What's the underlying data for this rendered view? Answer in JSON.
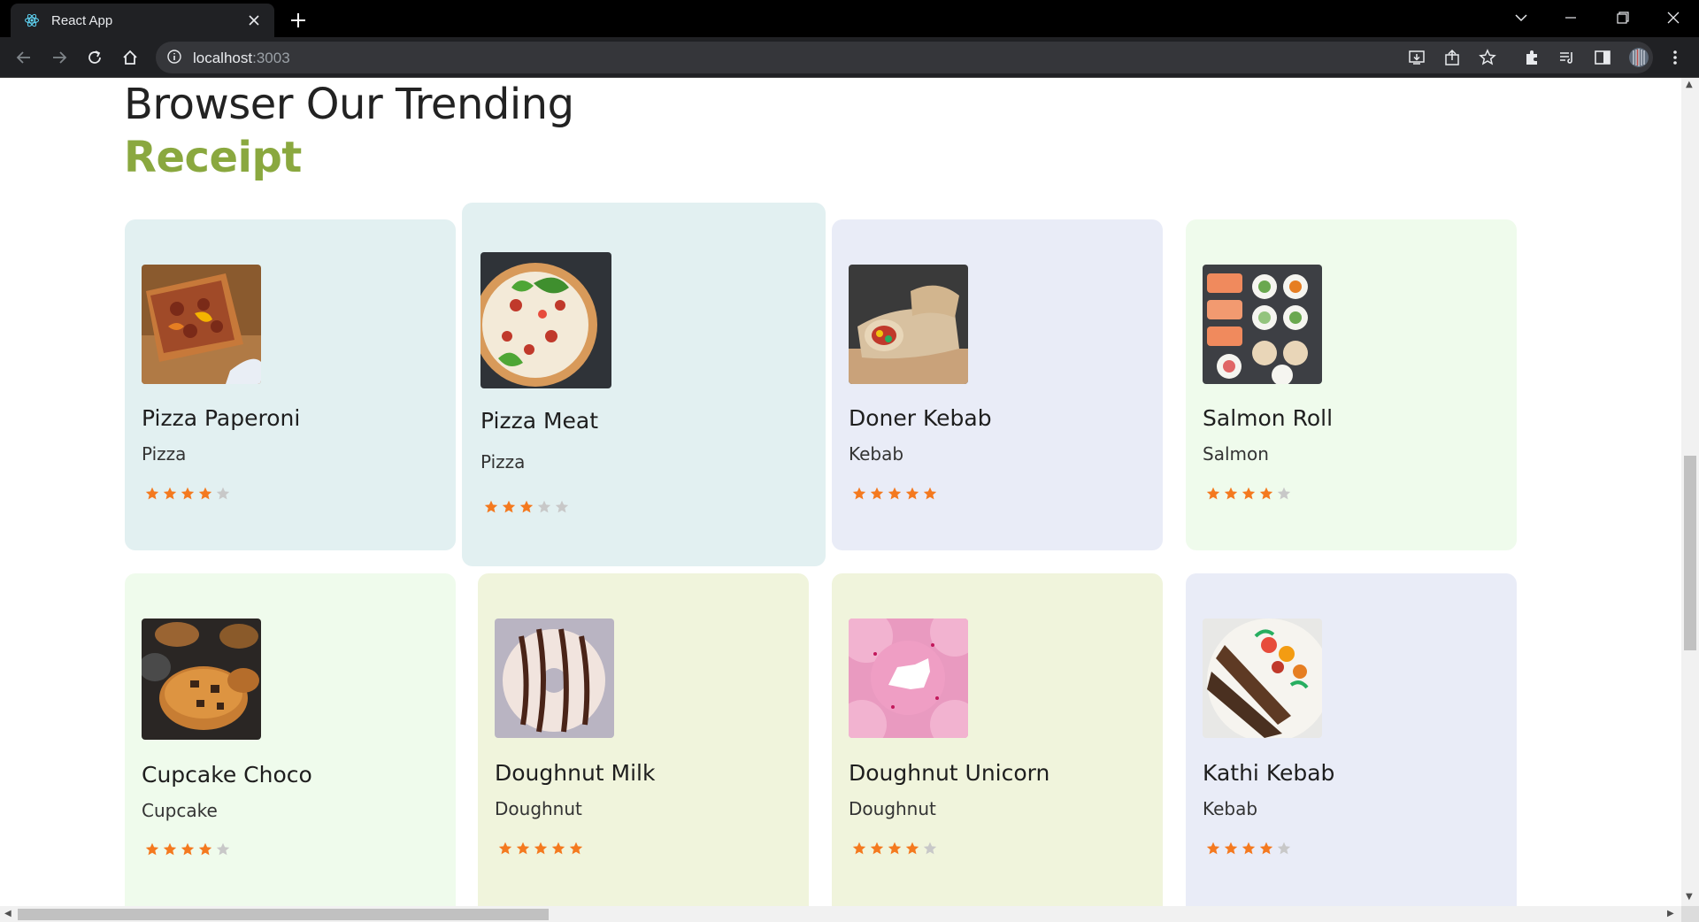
{
  "browser": {
    "tab_title": "React App",
    "url_host": "localhost",
    "url_port": ":3003"
  },
  "page": {
    "heading_line1": "Browser Our Trending",
    "heading_line2": "Receipt"
  },
  "colors": {
    "accent_green": "#8aa83f",
    "star_filled": "#f4791f",
    "star_empty": "#c8c8c8",
    "card_teal": "#e2f0f1",
    "card_lavender": "#e9ecf7",
    "card_mint": "#effbec",
    "card_lime": "#f0f4dc"
  },
  "cards": [
    {
      "name": "Pizza Paperoni",
      "category": "Pizza",
      "rating": 4,
      "image_icon": "pizza-slice-photo"
    },
    {
      "name": "Pizza Meat",
      "category": "Pizza",
      "rating": 3,
      "image_icon": "pizza-photo"
    },
    {
      "name": "Doner Kebab",
      "category": "Kebab",
      "rating": 5,
      "image_icon": "wrap-photo"
    },
    {
      "name": "Salmon Roll",
      "category": "Salmon",
      "rating": 4,
      "image_icon": "sushi-photo"
    },
    {
      "name": "Cupcake Choco",
      "category": "Cupcake",
      "rating": 4,
      "image_icon": "cupcake-photo"
    },
    {
      "name": "Doughnut Milk",
      "category": "Doughnut",
      "rating": 5,
      "image_icon": "doughnut-photo"
    },
    {
      "name": "Doughnut Unicorn",
      "category": "Doughnut",
      "rating": 4,
      "image_icon": "pink-doughnut-photo"
    },
    {
      "name": "Kathi Kebab",
      "category": "Kebab",
      "rating": 4,
      "image_icon": "kebab-plate-photo"
    }
  ]
}
